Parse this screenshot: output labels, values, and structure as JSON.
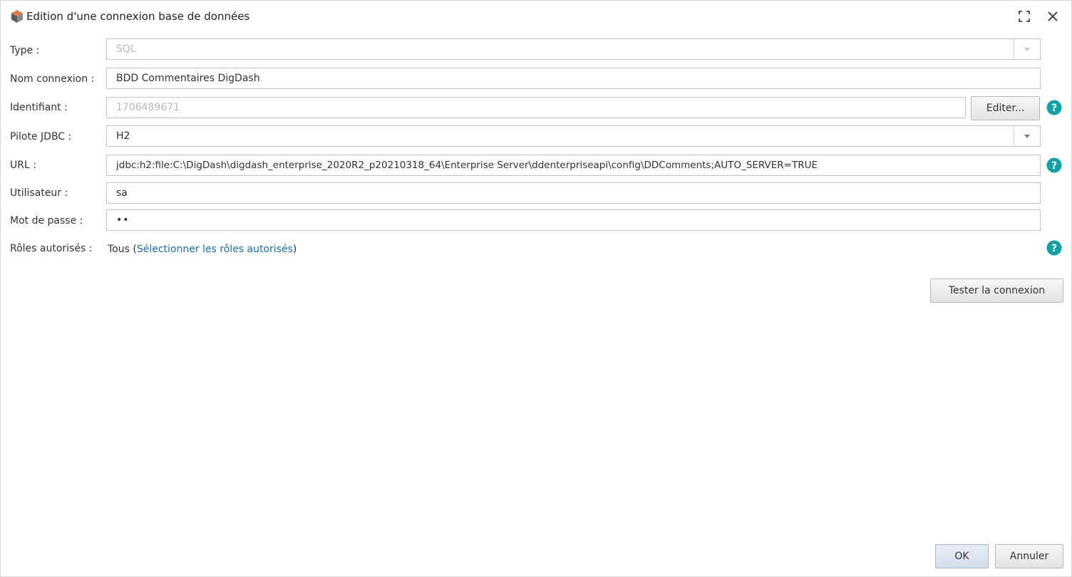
{
  "window": {
    "title": "Edition d'une connexion base de données"
  },
  "form": {
    "type": {
      "label": "Type :",
      "value": "SQL"
    },
    "name": {
      "label": "Nom connexion :",
      "value": "BDD Commentaires DigDash"
    },
    "identifier": {
      "label": "Identifiant :",
      "value": "1706489671",
      "edit_button": "Editer..."
    },
    "jdbc_driver": {
      "label": "Pilote JDBC :",
      "value": "H2"
    },
    "url": {
      "label": "URL :",
      "value": "jdbc:h2:file:C:\\DigDash\\digdash_enterprise_2020R2_p20210318_64\\Enterprise Server\\ddenterpriseapi\\config\\DDComments;AUTO_SERVER=TRUE"
    },
    "user": {
      "label": "Utilisateur :",
      "value": "sa"
    },
    "password": {
      "label": "Mot de passe :",
      "value": "••"
    },
    "roles": {
      "label": "Rôles autorisés :",
      "value": "Tous",
      "open_paren": "(",
      "link": "Sélectionner les rôles autorisés",
      "close_paren": ")"
    }
  },
  "buttons": {
    "test_connection": "Tester la connexion",
    "ok": "OK",
    "cancel": "Annuler"
  },
  "icons": {
    "app": "database-cube-icon",
    "maximize": "maximize-icon",
    "close": "close-icon",
    "help": "help-icon"
  },
  "colors": {
    "help": "#11a0a6",
    "link": "#1a6db5",
    "ok_button": "#d3ddeb"
  }
}
